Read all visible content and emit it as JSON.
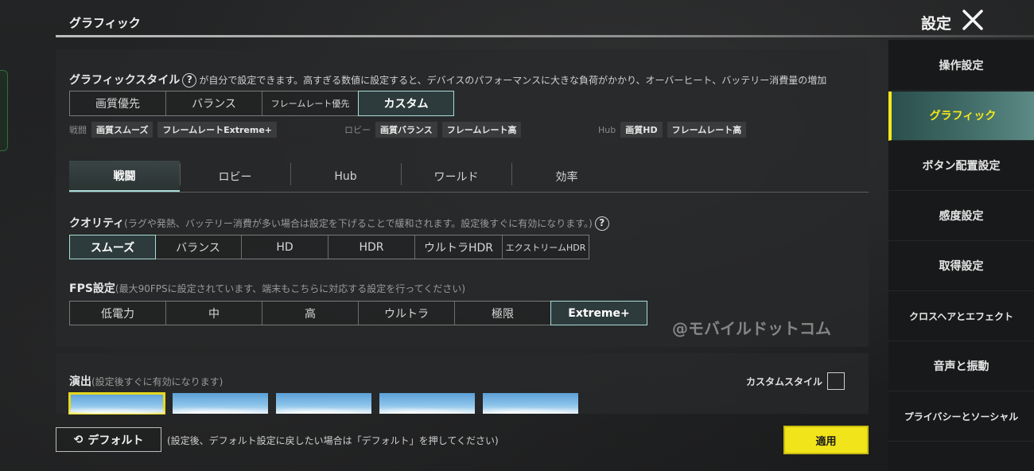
{
  "header": {
    "title": "グラフィック",
    "settings_label": "設定"
  },
  "graphic_style": {
    "label": "グラフィックスタイル",
    "description": "が自分で設定できます。高すぎる数値に設定すると、デバイスのパフォーマンスに大きな負荷がかかり、オーバーヒート、バッテリー消費量の増加",
    "options": [
      "画質優先",
      "バランス",
      "フレームレート優先",
      "カスタム"
    ],
    "selected": "カスタム"
  },
  "presets": {
    "battle": {
      "label": "戦闘",
      "chips": [
        "画質スムーズ",
        "フレームレートExtreme+"
      ]
    },
    "lobby": {
      "label": "ロビー",
      "chips": [
        "画質バランス",
        "フレームレート高"
      ]
    },
    "hub": {
      "label": "Hub",
      "chips": [
        "画質HD",
        "フレームレート高"
      ]
    }
  },
  "tabs": [
    "戦闘",
    "ロビー",
    "Hub",
    "ワールド",
    "効率"
  ],
  "active_tab": "戦闘",
  "quality": {
    "label": "クオリティ",
    "hint": "(ラグや発熱、バッテリー消費が多い場合は設定を下げることで緩和されます。設定後すぐに有効になります。)",
    "options": [
      "スムーズ",
      "バランス",
      "HD",
      "HDR",
      "ウルトラHDR",
      "エクストリームHDR"
    ],
    "selected": "スムーズ"
  },
  "fps": {
    "label": "FPS設定",
    "hint": "(最大90FPSに設定されています、端末もこちらに対応する設定を行ってください)",
    "options": [
      "低電力",
      "中",
      "高",
      "ウルトラ",
      "極限",
      "Extreme+"
    ],
    "selected": "Extreme+"
  },
  "watermark": "@モバイルドットコム",
  "effects": {
    "label": "演出",
    "hint": "(設定後すぐに有効になります)",
    "custom_style_label": "カスタムスタイル"
  },
  "bottom": {
    "default_label": "デフォルト",
    "default_hint": "(設定後、デフォルト設定に戻したい場合は「デフォルト」を押してください)",
    "apply_label": "適用"
  },
  "sidebar": {
    "items": [
      "操作設定",
      "グラフィック",
      "ボタン配置設定",
      "感度設定",
      "取得設定",
      "クロスヘアとエフェクト",
      "音声と振動",
      "プライバシーとソーシャル"
    ],
    "active": "グラフィック"
  },
  "colors": {
    "accent_teal": "#a9dcd9",
    "accent_yellow": "#f1e41a"
  }
}
